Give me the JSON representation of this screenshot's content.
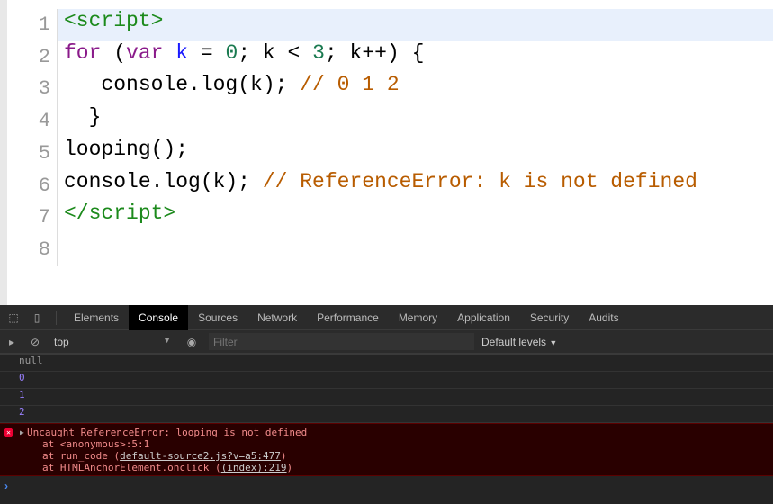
{
  "editor": {
    "line_numbers": [
      "1",
      "2",
      "3",
      "4",
      "5",
      "6",
      "7",
      "8"
    ],
    "lines": [
      [
        {
          "t": "<script>",
          "c": "tag"
        }
      ],
      [
        {
          "t": "for",
          "c": "kw"
        },
        {
          "t": " (",
          "c": ""
        },
        {
          "t": "var",
          "c": "kw"
        },
        {
          "t": " ",
          "c": ""
        },
        {
          "t": "k",
          "c": "var"
        },
        {
          "t": " = ",
          "c": ""
        },
        {
          "t": "0",
          "c": "num"
        },
        {
          "t": "; k < ",
          "c": ""
        },
        {
          "t": "3",
          "c": "num"
        },
        {
          "t": "; k++) {",
          "c": ""
        }
      ],
      [
        {
          "t": "   console.log(k); ",
          "c": ""
        },
        {
          "t": "// 0 1 2",
          "c": "cm"
        }
      ],
      [
        {
          "t": "  }",
          "c": ""
        }
      ],
      [
        {
          "t": "looping();",
          "c": ""
        }
      ],
      [
        {
          "t": "console.log(k); ",
          "c": ""
        },
        {
          "t": "// ReferenceError: k is not defined",
          "c": "cm"
        }
      ],
      [
        {
          "t": "</script>",
          "c": "tag"
        }
      ],
      []
    ]
  },
  "devtools": {
    "tabs": [
      "Elements",
      "Console",
      "Sources",
      "Network",
      "Performance",
      "Memory",
      "Application",
      "Security",
      "Audits"
    ],
    "selected_tab": "Console",
    "context": "top",
    "filter_placeholder": "Filter",
    "levels": "Default levels",
    "logs": [
      "null",
      "0",
      "1",
      "2"
    ],
    "error": {
      "message": "Uncaught ReferenceError: looping is not defined",
      "stack1": "at <anonymous>:5:1",
      "stack2_pre": "at run_code (",
      "stack2_link": "default-source2.js?v=a5:477",
      "stack2_post": ")",
      "stack3_pre": "at HTMLAnchorElement.onclick (",
      "stack3_link": "(index):219",
      "stack3_post": ")"
    },
    "prompt": "›"
  }
}
